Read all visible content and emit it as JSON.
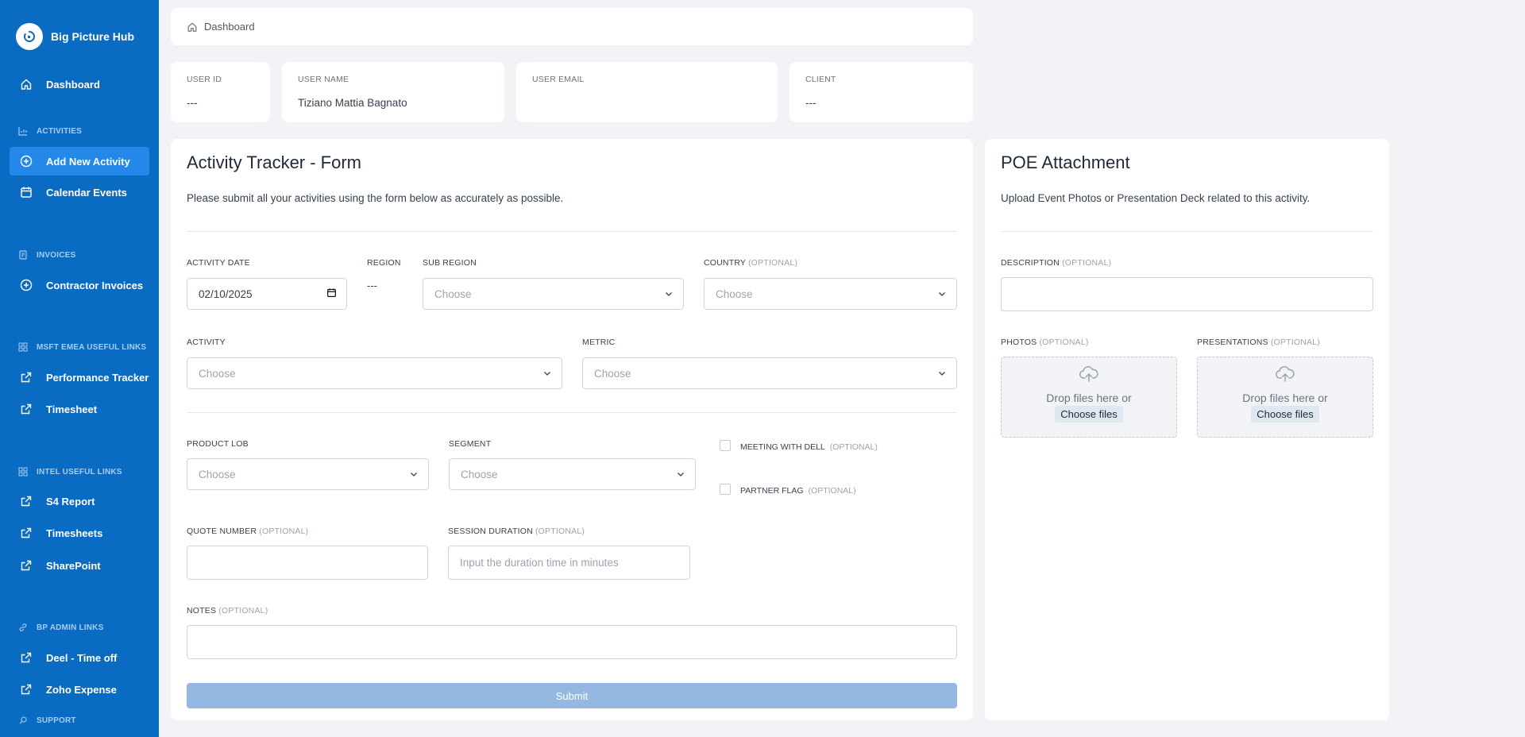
{
  "app": {
    "name": "Big Picture Hub"
  },
  "sidebar": {
    "dashboard": "Dashboard",
    "sections": {
      "activities": "ACTIVITIES",
      "invoices": "INVOICES",
      "msft": "MSFT EMEA USEFUL LINKS",
      "intel": "INTEL USEFUL LINKS",
      "bp_admin": "BP ADMIN LINKS",
      "support": "SUPPORT"
    },
    "items": {
      "add_new_activity": "Add New Activity",
      "calendar_events": "Calendar Events",
      "contractor_invoices": "Contractor Invoices",
      "performance_tracker": "Performance Tracker",
      "timesheet": "Timesheet",
      "s4_report": "S4 Report",
      "timesheets": "Timesheets",
      "sharepoint": "SharePoint",
      "deel_time_off": "Deel - Time off",
      "zoho_expense": "Zoho Expense"
    },
    "active": "Add New Activity"
  },
  "breadcrumb": {
    "label": "Dashboard"
  },
  "user_info": {
    "user_id": {
      "label": "USER ID",
      "value": "---"
    },
    "user_name": {
      "label": "USER NAME",
      "value": "Tiziano Mattia Bagnato"
    },
    "user_email": {
      "label": "USER EMAIL",
      "value": ""
    },
    "client": {
      "label": "CLIENT",
      "value": "---"
    }
  },
  "form": {
    "title": "Activity Tracker - Form",
    "subtitle": "Please submit all your activities using the form below as accurately as possible.",
    "optional": "(OPTIONAL)",
    "activity_date": {
      "label": "ACTIVITY DATE",
      "value": "02/10/2025"
    },
    "region": {
      "label": "REGION",
      "value": "---"
    },
    "sub_region": {
      "label": "SUB REGION",
      "placeholder": "Choose"
    },
    "country": {
      "label": "COUNTRY",
      "placeholder": "Choose"
    },
    "activity": {
      "label": "ACTIVITY",
      "placeholder": "Choose"
    },
    "metric": {
      "label": "METRIC",
      "placeholder": "Choose"
    },
    "product_lob": {
      "label": "PRODUCT LOB",
      "placeholder": "Choose"
    },
    "segment": {
      "label": "SEGMENT",
      "placeholder": "Choose"
    },
    "meeting_with_dell": {
      "label": "MEETING WITH DELL",
      "checked": false
    },
    "partner_flag": {
      "label": "PARTNER FLAG",
      "checked": false
    },
    "quote_number": {
      "label": "QUOTE NUMBER",
      "value": ""
    },
    "session_duration": {
      "label": "SESSION DURATION",
      "placeholder": "Input the duration time in minutes"
    },
    "notes": {
      "label": "NOTES",
      "value": ""
    },
    "submit_label": "Submit"
  },
  "poe": {
    "title": "POE Attachment",
    "subtitle": "Upload Event Photos or Presentation Deck related to this activity.",
    "description": {
      "label": "DESCRIPTION"
    },
    "photos": {
      "label": "PHOTOS"
    },
    "presentations": {
      "label": "PRESENTATIONS"
    },
    "drop_text": "Drop files here or",
    "choose_files": "Choose files"
  },
  "colors": {
    "sidebar": "#0a6bc2",
    "active_item": "#2388e8",
    "submit_disabled": "#95b8e2",
    "background": "#f1f3f6"
  },
  "icons": {
    "dashboard": "home-icon",
    "activities": "chart-icon",
    "add": "plus-circle-icon",
    "calendar": "calendar-icon",
    "invoices": "document-icon",
    "links": "grid-icon",
    "external": "external-link-icon",
    "admin": "link-icon",
    "support": "support-icon",
    "upload": "cloud-upload-icon"
  }
}
